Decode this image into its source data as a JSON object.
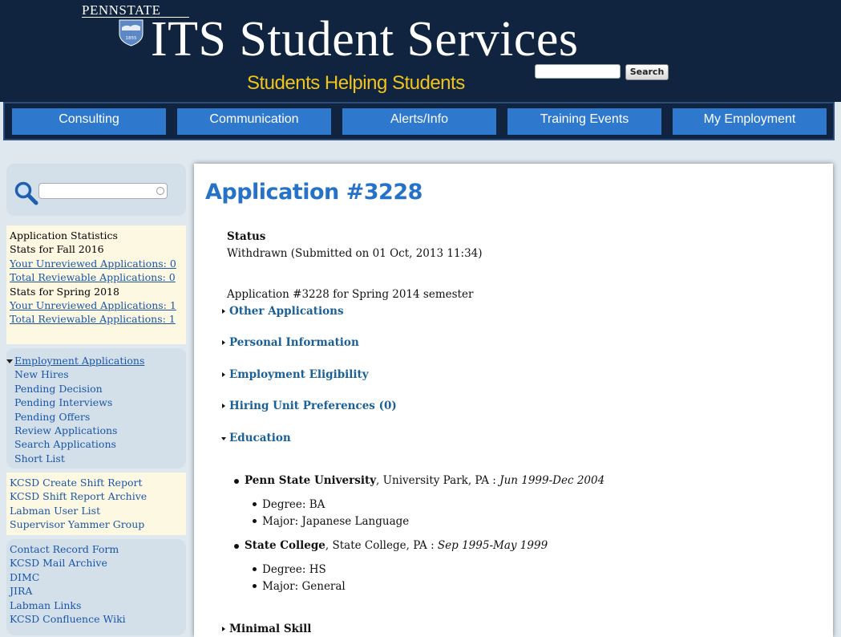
{
  "header": {
    "logo_text": "PENNSTATE",
    "shield_year": "1855",
    "title": "ITS Student Services",
    "tagline": "Students Helping Students",
    "search_button": "Search",
    "search_value": ""
  },
  "nav": {
    "items": [
      "Consulting",
      "Communication",
      "Alerts/Info",
      "Training Events",
      "My Employment"
    ]
  },
  "sidebar": {
    "search_value": "",
    "stats": {
      "heading": "Application Statistics",
      "fall_label": "Stats for Fall 2016",
      "fall_unreviewed": "Your Unreviewed Applications: 0",
      "fall_total": "Total Reviewable Applications: 0",
      "spring_label": "Stats for Spring 2018",
      "spring_unreviewed": "Your Unreviewed Applications: 1",
      "spring_total": "Total Reviewable Applications: 1"
    },
    "employment": {
      "heading": "Employment Applications",
      "items": [
        "New Hires",
        "Pending Decision",
        "Pending Interviews",
        "Pending Offers",
        "Review Applications",
        "Search Applications",
        "Short List"
      ]
    },
    "kcsd_links": [
      "KCSD Create Shift Report",
      "KCSD Shift Report Archive",
      "Labman User List",
      "Supervisor Yammer Group"
    ],
    "misc_links": [
      "Contact Record Form",
      "KCSD Mail Archive",
      "DIMC",
      "JIRA",
      "Labman Links",
      "KCSD Confluence Wiki"
    ]
  },
  "main": {
    "title": "Application #3228",
    "status_label": "Status",
    "status_value": "Withdrawn (Submitted on 01 Oct, 2013 11:34)",
    "semester_line": "Application #3228 for Spring 2014 semester",
    "sections": {
      "other": "Other Applications",
      "personal": "Personal Information",
      "eligibility": "Employment Eligibility",
      "hiring": "Hiring Unit Preferences (0)",
      "education": "Education",
      "next_partial": "Minimal Skill"
    },
    "education": [
      {
        "school": "Penn State University",
        "location": ", University Park, PA : ",
        "dates": "Jun 1999-Dec 2004",
        "degree": "Degree: BA",
        "major": "Major: Japanese Language"
      },
      {
        "school": "State College",
        "location": ", State College, PA : ",
        "dates": "Sep 1995-May 1999",
        "degree": "Degree: HS",
        "major": "Major: General"
      }
    ]
  },
  "colors": {
    "header_bg": "#10233f",
    "nav_button": "#2e79cd",
    "tagline": "#f0c419",
    "title_blue": "#2672c8",
    "section_link": "#1a6096"
  }
}
